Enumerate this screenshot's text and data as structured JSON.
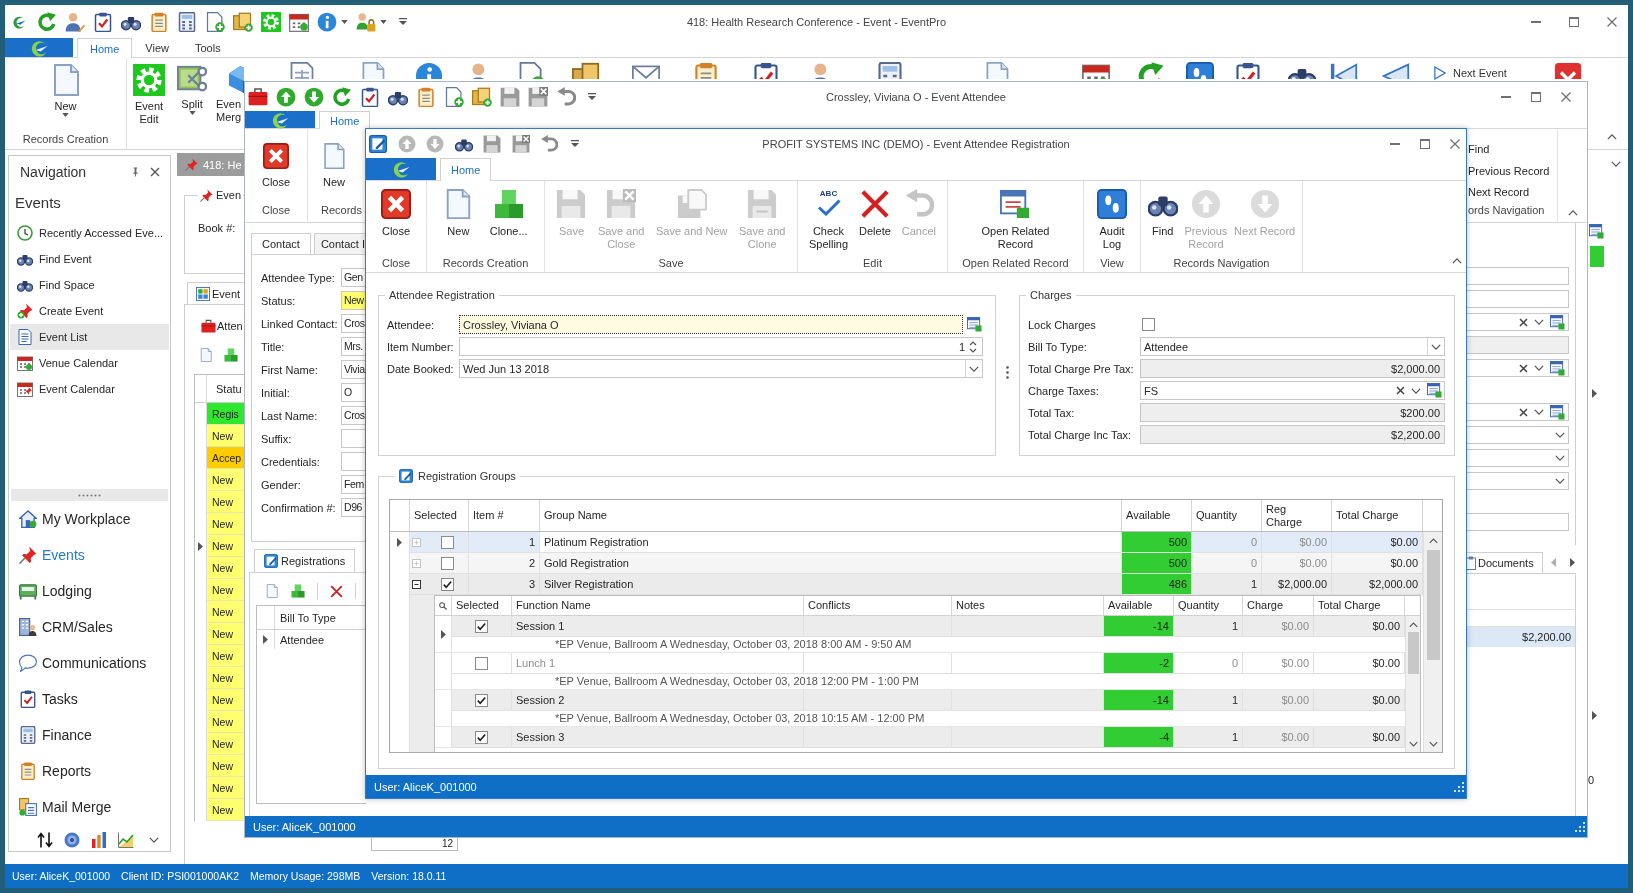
{
  "main_window": {
    "title": "418: Health Research Conference - Event - EventPro",
    "ribbon_tabs": [
      {
        "label": "Home",
        "selected": true
      },
      {
        "label": "View",
        "selected": false
      },
      {
        "label": "Tools",
        "selected": false
      }
    ],
    "ribbon_groups": [
      {
        "label": "Records Creation",
        "buttons": [
          {
            "label": [
              "New"
            ],
            "dropdown": true
          }
        ]
      },
      {
        "buttons": [
          {
            "label": [
              "Event",
              "Edit"
            ],
            "dropdown": false
          },
          {
            "label": [
              "Split"
            ],
            "dropdown": true
          },
          {
            "label": [
              "Even",
              "Merg"
            ],
            "dropdown": false
          }
        ]
      }
    ],
    "next_event_button": "Next Event",
    "navigation": {
      "title": "Navigation",
      "section": "Events",
      "items": [
        {
          "label": "Recently Accessed Eve...",
          "selected": false
        },
        {
          "label": "Find Event",
          "selected": false
        },
        {
          "label": "Find Space",
          "selected": false
        },
        {
          "label": "Create Event",
          "selected": false
        },
        {
          "label": "Event List",
          "selected": true
        },
        {
          "label": "Venue Calendar",
          "selected": false
        },
        {
          "label": "Event Calendar",
          "selected": false
        }
      ],
      "modules": [
        {
          "label": "My Workplace",
          "selected": false
        },
        {
          "label": "Events",
          "selected": true
        },
        {
          "label": "Lodging",
          "selected": false
        },
        {
          "label": "CRM/Sales",
          "selected": false
        },
        {
          "label": "Communications",
          "selected": false
        },
        {
          "label": "Tasks",
          "selected": false
        },
        {
          "label": "Finance",
          "selected": false
        },
        {
          "label": "Reports",
          "selected": false
        },
        {
          "label": "Mail Merge",
          "selected": false
        }
      ]
    },
    "document_tab": "418: He",
    "event_group": {
      "title": "Even",
      "book_label": "Book #:"
    },
    "event_tab": "Event",
    "attendees": {
      "title": "Atten",
      "column": "Statu",
      "rows": [
        {
          "status": "Regis",
          "color": "#2ee82e",
          "current": false
        },
        {
          "status": "New",
          "color": "#ffff70",
          "current": false
        },
        {
          "status": "Accep",
          "color": "#ffcc00",
          "current": false
        },
        {
          "status": "New",
          "color": "#ffff70",
          "current": false
        },
        {
          "status": "New",
          "color": "#ffff70",
          "current": false
        },
        {
          "status": "New",
          "color": "#ffff70",
          "current": false
        },
        {
          "status": "New",
          "color": "#ffff70",
          "current": true
        },
        {
          "status": "New",
          "color": "#ffff70",
          "current": false
        },
        {
          "status": "New",
          "color": "#ffff70",
          "current": false
        },
        {
          "status": "New",
          "color": "#ffff70",
          "current": false
        },
        {
          "status": "New",
          "color": "#ffff70",
          "current": false
        },
        {
          "status": "New",
          "color": "#ffff70",
          "current": false
        },
        {
          "status": "New",
          "color": "#ffff70",
          "current": false
        },
        {
          "status": "New",
          "color": "#ffff70",
          "current": false
        },
        {
          "status": "New",
          "color": "#ffff70",
          "current": false
        },
        {
          "status": "New",
          "color": "#ffff70",
          "current": false
        },
        {
          "status": "New",
          "color": "#ffff70",
          "current": false
        },
        {
          "status": "New",
          "color": "#ffff70",
          "current": false
        },
        {
          "status": "New",
          "color": "#ffff70",
          "current": false
        }
      ]
    },
    "footer_field": "12",
    "edge_text": "0",
    "status_bar": [
      "User: AliceK_001000",
      "Client ID: PSI001000AK2",
      "Memory Usage: 298MB",
      "Version: 18.0.11"
    ]
  },
  "attendee_window": {
    "title": "Crossley, Viviana O - Event Attendee",
    "ribbon_tabs": [
      {
        "label": "Home",
        "selected": true
      }
    ],
    "ribbon_groups": [
      {
        "label": "Close",
        "buttons": [
          "Close"
        ]
      },
      {
        "label": "Records",
        "buttons": [
          "New"
        ]
      }
    ],
    "navigation_buttons": [
      "Find",
      "Previous Record",
      "Next Record"
    ],
    "navigation_group": "ords Navigation",
    "contact_tabs": [
      {
        "label": "Contact",
        "selected": true
      },
      {
        "label": "Contact I",
        "selected": false
      }
    ],
    "contact_fields": [
      {
        "label": "Attendee Type:",
        "value": "Gen",
        "highlighted": false
      },
      {
        "label": "Status:",
        "value": "New",
        "highlighted": true
      },
      {
        "label": "Linked Contact:",
        "value": "Cros",
        "highlighted": false
      },
      {
        "label": "Title:",
        "value": "Mrs.",
        "highlighted": false
      },
      {
        "label": "First Name:",
        "value": "Vivia",
        "highlighted": false
      },
      {
        "label": "Initial:",
        "value": "O",
        "highlighted": false
      },
      {
        "label": "Last Name:",
        "value": "Cros",
        "highlighted": false
      },
      {
        "label": "Suffix:",
        "highlighted": false
      },
      {
        "label": "Credentials:",
        "highlighted": false
      },
      {
        "label": "Gender:",
        "value": "Fem",
        "highlighted": false
      },
      {
        "label": "Confirmation #:",
        "value": "D96",
        "highlighted": false
      }
    ],
    "registrations_tab": "Registrations",
    "registrations_grid": {
      "column": "Bill To Type",
      "rows": [
        {
          "bill_to_type": "Attendee",
          "current": true
        }
      ]
    },
    "side_fields": [
      {
        "kind": "text"
      },
      {
        "kind": "text"
      },
      {
        "kind": "lookup"
      },
      {
        "kind": "readonly"
      },
      {
        "kind": "lookup"
      },
      {
        "kind": "lookup"
      },
      {
        "kind": "dropdown"
      },
      {
        "kind": "dropdown"
      },
      {
        "kind": "dropdown"
      },
      {
        "kind": "text"
      }
    ],
    "documents_tab": "Documents",
    "side_grid_rows": [
      {
        "value": "$2,200.00",
        "selected": true
      }
    ],
    "status_bar": "User: AliceK_001000"
  },
  "registration_dialog": {
    "title": "PROFIT SYSTEMS INC (DEMO) - Event Attendee Registration",
    "ribbon_tabs": [
      {
        "label": "Home",
        "selected": true
      }
    ],
    "ribbon_groups": [
      {
        "label": "Close",
        "buttons": [
          {
            "label": [
              "Close"
            ],
            "disabled": false
          }
        ]
      },
      {
        "label": "Records Creation",
        "buttons": [
          {
            "label": [
              "New"
            ],
            "disabled": false
          },
          {
            "label": [
              "Clone..."
            ],
            "disabled": false
          }
        ]
      },
      {
        "label": "Save",
        "buttons": [
          {
            "label": [
              "Save"
            ],
            "disabled": true
          },
          {
            "label": [
              "Save and",
              "Close"
            ],
            "disabled": true
          },
          {
            "label": [
              "Save and New"
            ],
            "disabled": true
          },
          {
            "label": [
              "Save and",
              "Clone"
            ],
            "disabled": true
          }
        ]
      },
      {
        "label": "Edit",
        "buttons": [
          {
            "label": [
              "Check",
              "Spelling"
            ],
            "disabled": false,
            "icon_text": "ABC"
          },
          {
            "label": [
              "Delete"
            ],
            "disabled": false
          },
          {
            "label": [
              "Cancel"
            ],
            "disabled": true
          }
        ]
      },
      {
        "label": "Open Related Record",
        "buttons": [
          {
            "label": [
              "Open Related",
              "Record"
            ],
            "disabled": false
          }
        ]
      },
      {
        "label": "View",
        "buttons": [
          {
            "label": [
              "Audit",
              "Log"
            ],
            "disabled": false
          }
        ]
      },
      {
        "label": "Records Navigation",
        "buttons": [
          {
            "label": [
              "Find"
            ],
            "disabled": false
          },
          {
            "label": [
              "Previous",
              "Record"
            ],
            "disabled": true
          },
          {
            "label": [
              "Next Record"
            ],
            "disabled": true
          }
        ]
      }
    ],
    "attendee_registration": {
      "title": "Attendee Registration",
      "fields": [
        {
          "kind": "lookup",
          "label": "Attendee:",
          "value": "Crossley, Viviana O",
          "focused": true
        },
        {
          "kind": "spin",
          "label": "Item Number:",
          "value": "1",
          "focused": false
        },
        {
          "kind": "date",
          "label": "Date Booked:",
          "value": "Wed Jun 13 2018",
          "focused": false
        }
      ]
    },
    "charges": {
      "title": "Charges",
      "fields": [
        {
          "kind": "checkbox",
          "label": "Lock Charges",
          "checked": false
        },
        {
          "kind": "dropdown",
          "label": "Bill To Type:",
          "value": "Attendee"
        },
        {
          "kind": "readonly",
          "label": "Total Charge Pre Tax:",
          "value": "$2,000.00"
        },
        {
          "kind": "lookup",
          "label": "Charge Taxes:",
          "value": "FS"
        },
        {
          "kind": "readonly",
          "label": "Total Tax:",
          "value": "$200.00"
        },
        {
          "kind": "readonly",
          "label": "Total Charge Inc Tax:",
          "value": "$2,200.00"
        }
      ]
    },
    "registration_groups": {
      "title": "Registration Groups",
      "columns": [
        [
          "Selected"
        ],
        [
          "Item #"
        ],
        [
          "Group Name"
        ],
        [
          "Available"
        ],
        [
          "Quantity"
        ],
        [
          "Reg",
          "Charge"
        ],
        [
          "Total Charge"
        ]
      ],
      "rows": [
        {
          "checked": false,
          "expanded": false,
          "current": true,
          "item": "1",
          "name": "Platinum Registration",
          "available": "500",
          "quantity": "0",
          "reg_charge": "$0.00",
          "total_charge": "$0.00"
        },
        {
          "checked": false,
          "expanded": false,
          "current": false,
          "item": "2",
          "name": "Gold Registration",
          "available": "500",
          "quantity": "0",
          "reg_charge": "$0.00",
          "total_charge": "$0.00"
        },
        {
          "checked": true,
          "expanded": true,
          "current": false,
          "item": "3",
          "name": "Silver Registration",
          "available": "486",
          "quantity": "1",
          "reg_charge": "$2,000.00",
          "total_charge": "$2,000.00",
          "functions": {
            "columns": [
              "Selected",
              "Function Name",
              "Conflicts",
              "Notes",
              "Available",
              "Quantity",
              "Charge",
              "Total Charge"
            ],
            "rows": [
              {
                "checked": true,
                "current": true,
                "name": "Session 1",
                "available": "-14",
                "quantity": "1",
                "charge": "$0.00",
                "total_charge": "$0.00",
                "details": "*EP Venue, Ballroom A Wednesday, October 03, 2018 8:00 AM - 9:50 AM"
              },
              {
                "checked": false,
                "current": false,
                "name": "Lunch 1",
                "available": "-2",
                "quantity": "0",
                "charge": "$0.00",
                "total_charge": "$0.00",
                "details": "*EP Venue, Ballroom A Wednesday, October 03, 2018 12:00 PM - 1:00 PM"
              },
              {
                "checked": true,
                "current": false,
                "name": "Session 2",
                "available": "-14",
                "quantity": "1",
                "charge": "$0.00",
                "total_charge": "$0.00",
                "details": "*EP Venue, Ballroom A Wednesday, October 03, 2018 10:15 AM - 12:00 PM"
              },
              {
                "checked": true,
                "current": false,
                "name": "Session 3",
                "available": "-4",
                "quantity": "1",
                "charge": "$0.00",
                "total_charge": "$0.00"
              }
            ]
          }
        }
      ]
    },
    "status_bar": "User: AliceK_001000"
  }
}
